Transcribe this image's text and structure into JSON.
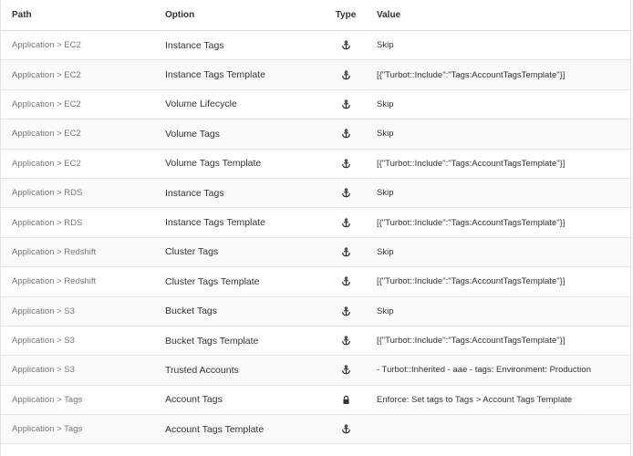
{
  "columns": {
    "path": "Path",
    "option": "Option",
    "type": "Type",
    "value": "Value"
  },
  "rows": [
    {
      "path": "Application > EC2",
      "option": "Instance Tags",
      "type_icon": "anchor-icon",
      "value": "Skip"
    },
    {
      "path": "Application > EC2",
      "option": "Instance Tags Template",
      "type_icon": "anchor-icon",
      "value": "[{\"Turbot::Include\":\"Tags:AccountTagsTemplate\"}]"
    },
    {
      "path": "Application > EC2",
      "option": "Volume Lifecycle",
      "type_icon": "anchor-icon",
      "value": "Skip"
    },
    {
      "path": "Application > EC2",
      "option": "Volume Tags",
      "type_icon": "anchor-icon",
      "value": "Skip"
    },
    {
      "path": "Application > EC2",
      "option": "Volume Tags Template",
      "type_icon": "anchor-icon",
      "value": "[{\"Turbot::Include\":\"Tags:AccountTagsTemplate\"}]"
    },
    {
      "path": "Application > RDS",
      "option": "Instance Tags",
      "type_icon": "anchor-icon",
      "value": "Skip"
    },
    {
      "path": "Application > RDS",
      "option": "Instance Tags Template",
      "type_icon": "anchor-icon",
      "value": "[{\"Turbot::Include\":\"Tags:AccountTagsTemplate\"}]"
    },
    {
      "path": "Application > Redshift",
      "option": "Cluster Tags",
      "type_icon": "anchor-icon",
      "value": "Skip"
    },
    {
      "path": "Application > Redshift",
      "option": "Cluster Tags Template",
      "type_icon": "anchor-icon",
      "value": "[{\"Turbot::Include\":\"Tags:AccountTagsTemplate\"}]"
    },
    {
      "path": "Application > S3",
      "option": "Bucket Tags",
      "type_icon": "anchor-icon",
      "value": "Skip"
    },
    {
      "path": "Application > S3",
      "option": "Bucket Tags Template",
      "type_icon": "anchor-icon",
      "value": "[{\"Turbot::Include\":\"Tags:AccountTagsTemplate\"}]"
    },
    {
      "path": "Application > S3",
      "option": "Trusted Accounts",
      "type_icon": "anchor-icon",
      "value": "- Turbot::Inherited - aae - tags: Environment: Production"
    },
    {
      "path": "Application > Tags",
      "option": "Account Tags",
      "type_icon": "lock-icon",
      "value": "Enforce: Set tags to Tags > Account Tags Template"
    },
    {
      "path": "Application > Tags",
      "option": "Account Tags Template",
      "type_icon": "anchor-icon",
      "value": ""
    }
  ]
}
